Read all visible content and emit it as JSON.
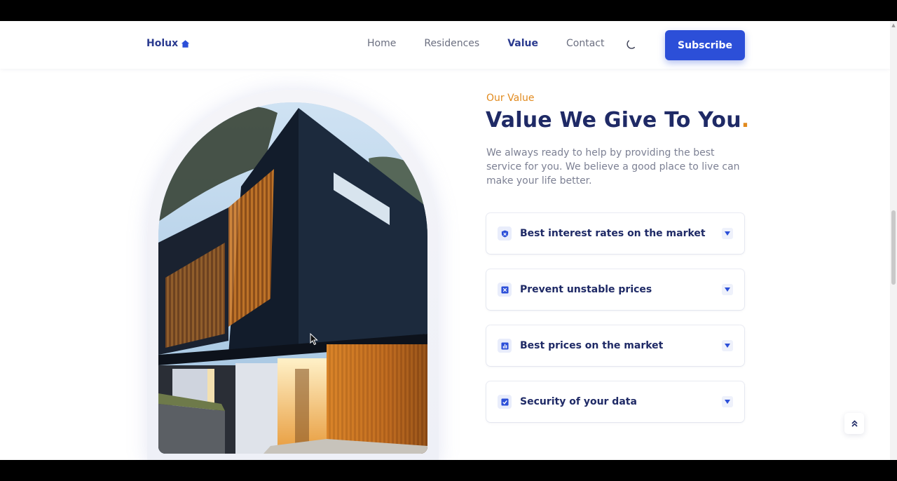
{
  "header": {
    "logo_text": "Holux",
    "logo_icon": "home-icon",
    "nav": [
      {
        "label": "Home",
        "active": false
      },
      {
        "label": "Residences",
        "active": false
      },
      {
        "label": "Value",
        "active": true
      },
      {
        "label": "Contact",
        "active": false
      }
    ],
    "theme_toggle_icon": "moon-icon",
    "subscribe_label": "Subscribe"
  },
  "value_section": {
    "subtitle": "Our Value",
    "title": "Value We Give To You",
    "title_dot": ".",
    "description": "We always ready to help by providing the best service for you. We believe a good place to live can make your life better.",
    "items": [
      {
        "label": "Best interest rates on the market",
        "icon": "shield-icon"
      },
      {
        "label": "Prevent unstable prices",
        "icon": "close-square-icon"
      },
      {
        "label": "Best prices on the market",
        "icon": "chart-icon"
      },
      {
        "label": "Security of your data",
        "icon": "check-square-icon"
      }
    ],
    "expand_icon": "caret-down-icon"
  },
  "scroll_top_icon": "double-chevron-up-icon",
  "colors": {
    "primary": "#2c4fd8",
    "heading": "#1f2a66",
    "accent": "#e18a1e",
    "body_text": "#7d8194"
  }
}
